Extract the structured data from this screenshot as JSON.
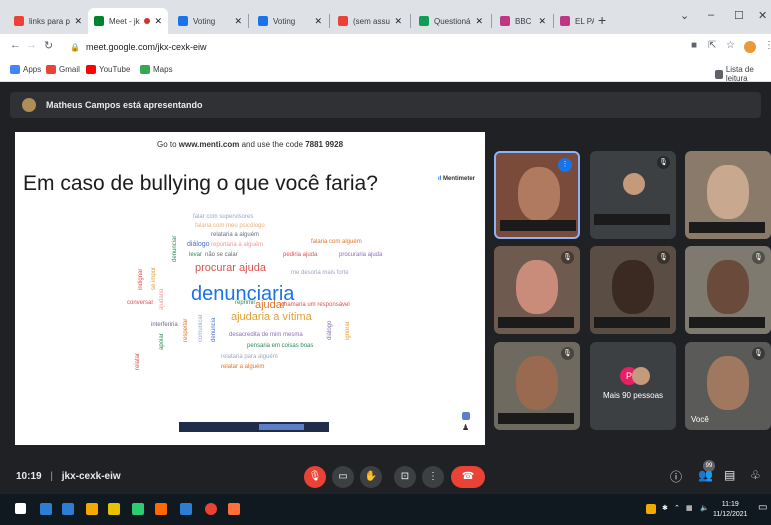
{
  "browser": {
    "tabs": [
      {
        "title": "links para pa",
        "favicon_color": "#ea4335",
        "active": false
      },
      {
        "title": "Meet - jk",
        "favicon_color": "#00832d",
        "active": true,
        "recording": true
      },
      {
        "title": "Voting",
        "favicon_color": "#1a73e8",
        "active": false
      },
      {
        "title": "Voting",
        "favicon_color": "#1a73e8",
        "active": false
      },
      {
        "title": "(sem assunto",
        "favicon_color": "#ea4335",
        "active": false
      },
      {
        "title": "Questionário",
        "favicon_color": "#0f9d58",
        "active": false
      },
      {
        "title": "BBC News | F",
        "favicon_color": "#c13584",
        "active": false
      },
      {
        "title": "EL PAÍS Brasil",
        "favicon_color": "#c13584",
        "active": false
      }
    ],
    "new_tab_label": "+",
    "window_controls": {
      "minimize": "–",
      "maximize": "☐",
      "close": "✕"
    },
    "url": "meet.google.com/jkx-cexk-eiw",
    "bookmarks": [
      {
        "label": "Apps",
        "color": "#4285f4"
      },
      {
        "label": "Gmail",
        "color": "#ea4335"
      },
      {
        "label": "YouTube",
        "color": "#ff0000"
      },
      {
        "label": "Maps",
        "color": "#34a853"
      }
    ],
    "reading_list": "Lista de leitura"
  },
  "meet": {
    "presenter_banner": "Matheus Campos está apresentando",
    "slide": {
      "instructions_prefix": "Go to ",
      "instructions_site": "www.menti.com",
      "instructions_mid": " and use the code ",
      "instructions_code": "7881 9928",
      "title": "Em caso de bullying o que você faria?",
      "brand": "Mentimeter",
      "word_cloud": [
        {
          "text": "falar com supervisores",
          "color": "#9aa7c7",
          "size": 6
        },
        {
          "text": "falaria com meu psicólogo",
          "color": "#e8b07a",
          "size": 6
        },
        {
          "text": "relataria a alguém",
          "color": "#6b6b8a",
          "size": 6
        },
        {
          "text": "reportaria à alguém",
          "color": "#e89a9a",
          "size": 6
        },
        {
          "text": "diálogo",
          "color": "#4a6fd0",
          "size": 7
        },
        {
          "text": "falaria com alguém",
          "color": "#e0752d",
          "size": 6
        },
        {
          "text": "levar",
          "color": "#2e8b57",
          "size": 6
        },
        {
          "text": "não se calar",
          "color": "#6c6c6c",
          "size": 6
        },
        {
          "text": "pediria ajuda",
          "color": "#d9534f",
          "size": 6
        },
        {
          "text": "procuraria ajuda",
          "color": "#8b6fb5",
          "size": 6
        },
        {
          "text": "procurar ajuda",
          "color": "#d9534f",
          "size": 11
        },
        {
          "text": "me desoria mais forte",
          "color": "#9aa7c7",
          "size": 6
        },
        {
          "text": "denunciaria",
          "color": "#1a73e8",
          "size": 20
        },
        {
          "text": "conversar",
          "color": "#d9534f",
          "size": 6
        },
        {
          "text": "reprimir",
          "color": "#2e8b57",
          "size": 6
        },
        {
          "text": "ajudar",
          "color": "#e0752d",
          "size": 11
        },
        {
          "text": "chamaria um responsável",
          "color": "#d9534f",
          "size": 6
        },
        {
          "text": "ajudaria a vítima",
          "color": "#e0a030",
          "size": 11
        },
        {
          "text": "interferiria",
          "color": "#6b6b8a",
          "size": 6
        },
        {
          "text": "desacredita de mim mesma",
          "color": "#8b6fb5",
          "size": 6
        },
        {
          "text": "pensaria em coisas boas",
          "color": "#2e8b57",
          "size": 6
        },
        {
          "text": "relataria para alguém",
          "color": "#9aa7c7",
          "size": 6
        },
        {
          "text": "relatar a alguém",
          "color": "#e0752d",
          "size": 6
        },
        {
          "text": "denunciar",
          "color": "#2e8b57",
          "size": 6
        },
        {
          "text": "indignar",
          "color": "#d9534f",
          "size": 6
        },
        {
          "text": "se impor",
          "color": "#e0a030",
          "size": 6
        },
        {
          "text": "ajudaria",
          "color": "#e89a9a",
          "size": 6
        },
        {
          "text": "comunicar",
          "color": "#9aa7c7",
          "size": 6
        },
        {
          "text": "respeitar",
          "color": "#e0752d",
          "size": 6
        },
        {
          "text": "denuncia",
          "color": "#4a6fd0",
          "size": 6
        },
        {
          "text": "diálogo",
          "color": "#8b6fb5",
          "size": 6
        },
        {
          "text": "ignorar",
          "color": "#e0a030",
          "size": 6
        },
        {
          "text": "relatar",
          "color": "#d9534f",
          "size": 6
        },
        {
          "text": "apoiar",
          "color": "#2e8b57",
          "size": 6
        }
      ]
    },
    "participants": [
      {
        "name": "",
        "muted": false,
        "speaking": true,
        "bg": "#7a4a3a",
        "face": "#b07a60"
      },
      {
        "name": "",
        "muted": true,
        "speaking": false,
        "bg": "#3c4043",
        "face": "#c49a7a"
      },
      {
        "name": "",
        "muted": false,
        "speaking": false,
        "bg": "#8a7a6a",
        "face": "#c9a890"
      },
      {
        "name": "",
        "muted": true,
        "speaking": false,
        "bg": "#6e5a4e",
        "face": "#c98b7a"
      },
      {
        "name": "",
        "muted": true,
        "speaking": false,
        "bg": "#5a4e44",
        "face": "#3a2a22"
      },
      {
        "name": "",
        "muted": true,
        "speaking": false,
        "bg": "#7e7a70",
        "face": "#6a4a3a"
      },
      {
        "name": "",
        "muted": true,
        "speaking": false,
        "bg": "#6e6a60",
        "face": "#9a6a50"
      },
      {
        "name": "Mais 90 pessoas",
        "muted": false,
        "speaking": false,
        "bg": "#3c4043",
        "face": ""
      },
      {
        "name": "Você",
        "muted": true,
        "speaking": false,
        "bg": "#5a5a58",
        "face": "#a07860"
      }
    ],
    "more_avatar_letter": "P",
    "bottom_bar": {
      "time": "10:19",
      "separator": "|",
      "meeting_code": "jkx-cexk-eiw",
      "participant_count": "99"
    }
  },
  "taskbar": {
    "apps": [
      {
        "color": "#ffffff"
      },
      {
        "color": "#2d7dd2"
      },
      {
        "color": "#2d7dd2"
      },
      {
        "color": "#f2a900"
      },
      {
        "color": "#e6c200"
      },
      {
        "color": "#2ecc71"
      },
      {
        "color": "#ff6a00"
      },
      {
        "color": "#2d7dd2"
      },
      {
        "color": "#ea4335"
      },
      {
        "color": "#ff7139"
      }
    ],
    "clock_time": "11:19",
    "clock_date": "11/12/2021"
  }
}
